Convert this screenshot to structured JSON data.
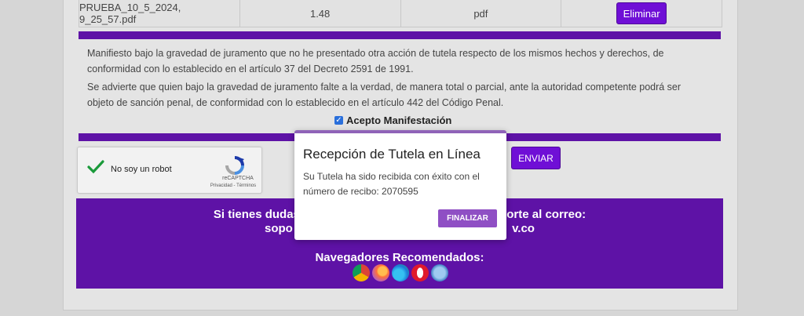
{
  "file_table": {
    "row": {
      "name": "PRUEBA_10_5_2024, 9_25_57.pdf",
      "size": "1.48",
      "type": "pdf",
      "action_label": "Eliminar"
    }
  },
  "manifest": {
    "para1": "Manifiesto bajo la gravedad de juramento que no he presentado otra acción de tutela respecto de los mismos hechos y derechos, de conformidad con lo establecido en el artículo 37 del Decreto 2591 de 1991.",
    "para2": "Se advierte que quien bajo la gravedad de juramento falte a la verdad, de manera total o parcial, ante la autoridad competente podrá ser objeto de sanción penal, de conformidad con lo establecido en el artículo 442 del Código Penal.",
    "accept_label": "Acepto Manifestación",
    "accept_checked": true
  },
  "recaptcha": {
    "label": "No soy un robot",
    "brand": "reCAPTCHA",
    "terms": "Privacidad - Términos"
  },
  "submit_label": "ENVIAR",
  "footer": {
    "line1": "Si tienes dudas o pr                                              e soporte al correo:",
    "line2": "sopo                                                                   v.co",
    "browsers_title": "Navegadores Recomendados:",
    "browsers": [
      "chrome-icon",
      "firefox-icon",
      "edge-icon",
      "opera-icon",
      "safari-icon"
    ]
  },
  "modal": {
    "title": "Recepción de Tutela en Línea",
    "body": "Su Tutela ha sido recibida con éxito con el número de recibo: 2070595",
    "button": "FINALIZAR"
  },
  "colors": {
    "brand_purple": "#5e12a6",
    "button_purple": "#6f0fd6",
    "modal_button": "#8f4fc4"
  }
}
